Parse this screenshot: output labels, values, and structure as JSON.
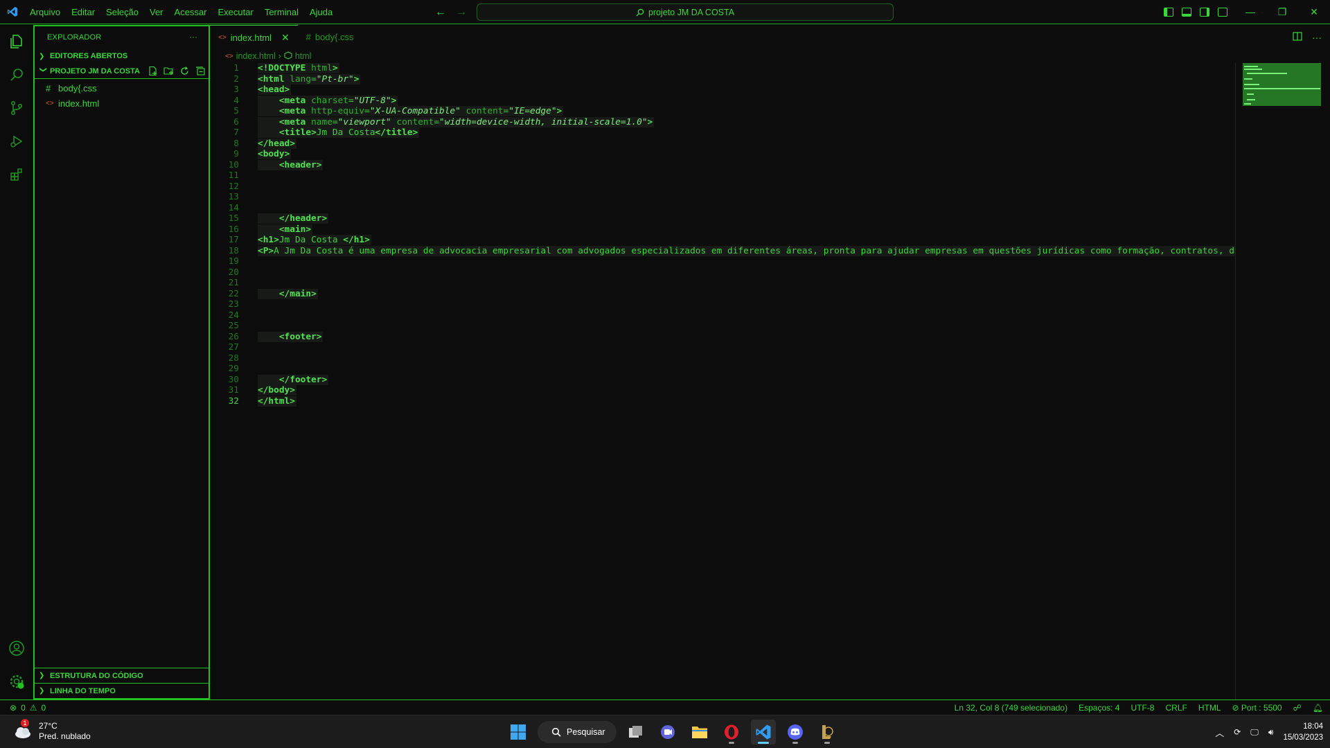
{
  "menu": [
    "Arquivo",
    "Editar",
    "Seleção",
    "Ver",
    "Acessar",
    "Executar",
    "Terminal",
    "Ajuda"
  ],
  "command_center": "projeto JM DA COSTA",
  "window_controls": {
    "minimize": "—",
    "restore": "❐",
    "close": "✕"
  },
  "sidebar": {
    "title": "EXPLORADOR",
    "more": "···",
    "open_editors": "EDITORES ABERTOS",
    "project": "PROJETO JM DA COSTA",
    "files": [
      {
        "icon": "#",
        "name": "body{.css"
      },
      {
        "icon": "<>",
        "name": "index.html"
      }
    ],
    "outline": "ESTRUTURA DO CÓDIGO",
    "timeline": "LINHA DO TEMPO"
  },
  "tabs": [
    {
      "icon": "<>",
      "label": "index.html",
      "close": "✕"
    },
    {
      "icon": "#",
      "label": "body{.css"
    }
  ],
  "breadcrumb": {
    "file": "index.html",
    "node": "html"
  },
  "code_lines": [
    "<!DOCTYPE html>",
    "<html lang=\"Pt-br\">",
    "<head>",
    "    <meta charset=\"UTF-8\">",
    "    <meta http-equiv=\"X-UA-Compatible\" content=\"IE=edge\">",
    "    <meta name=\"viewport\" content=\"width=device-width, initial-scale=1.0\">",
    "    <title>Jm Da Costa</title>",
    "</head>",
    "<body>",
    "    <header>",
    "",
    "",
    "",
    "",
    "    </header>",
    "    <main>",
    "<h1>Jm Da Costa </h1>",
    "<P>A Jm Da Costa é uma empresa de advocacia empresarial com advogados especializados em diferentes áreas, pronta para ajudar empresas em questões jurídicas como formação, contratos, di",
    "",
    "",
    "",
    "    </main>",
    "",
    "",
    "",
    "    <footer>",
    "",
    "",
    "",
    "    </footer>",
    "</body>",
    "</html>"
  ],
  "current_line": 32,
  "status": {
    "errors": "0",
    "warnings": "0",
    "position": "Ln 32, Col 8 (749 selecionado)",
    "spaces": "Espaços: 4",
    "encoding": "UTF-8",
    "eol": "CRLF",
    "language": "HTML",
    "port": "Port : 5500"
  },
  "taskbar": {
    "weather_temp": "27°C",
    "weather_desc": "Pred. nublado",
    "weather_badge": "1",
    "search": "Pesquisar",
    "time": "18:04",
    "date": "15/03/2023"
  },
  "colors": {
    "accent": "#3ad83a",
    "border": "#23c023",
    "bg": "#0c0c0c",
    "taskbar": "#1c1c1c"
  }
}
